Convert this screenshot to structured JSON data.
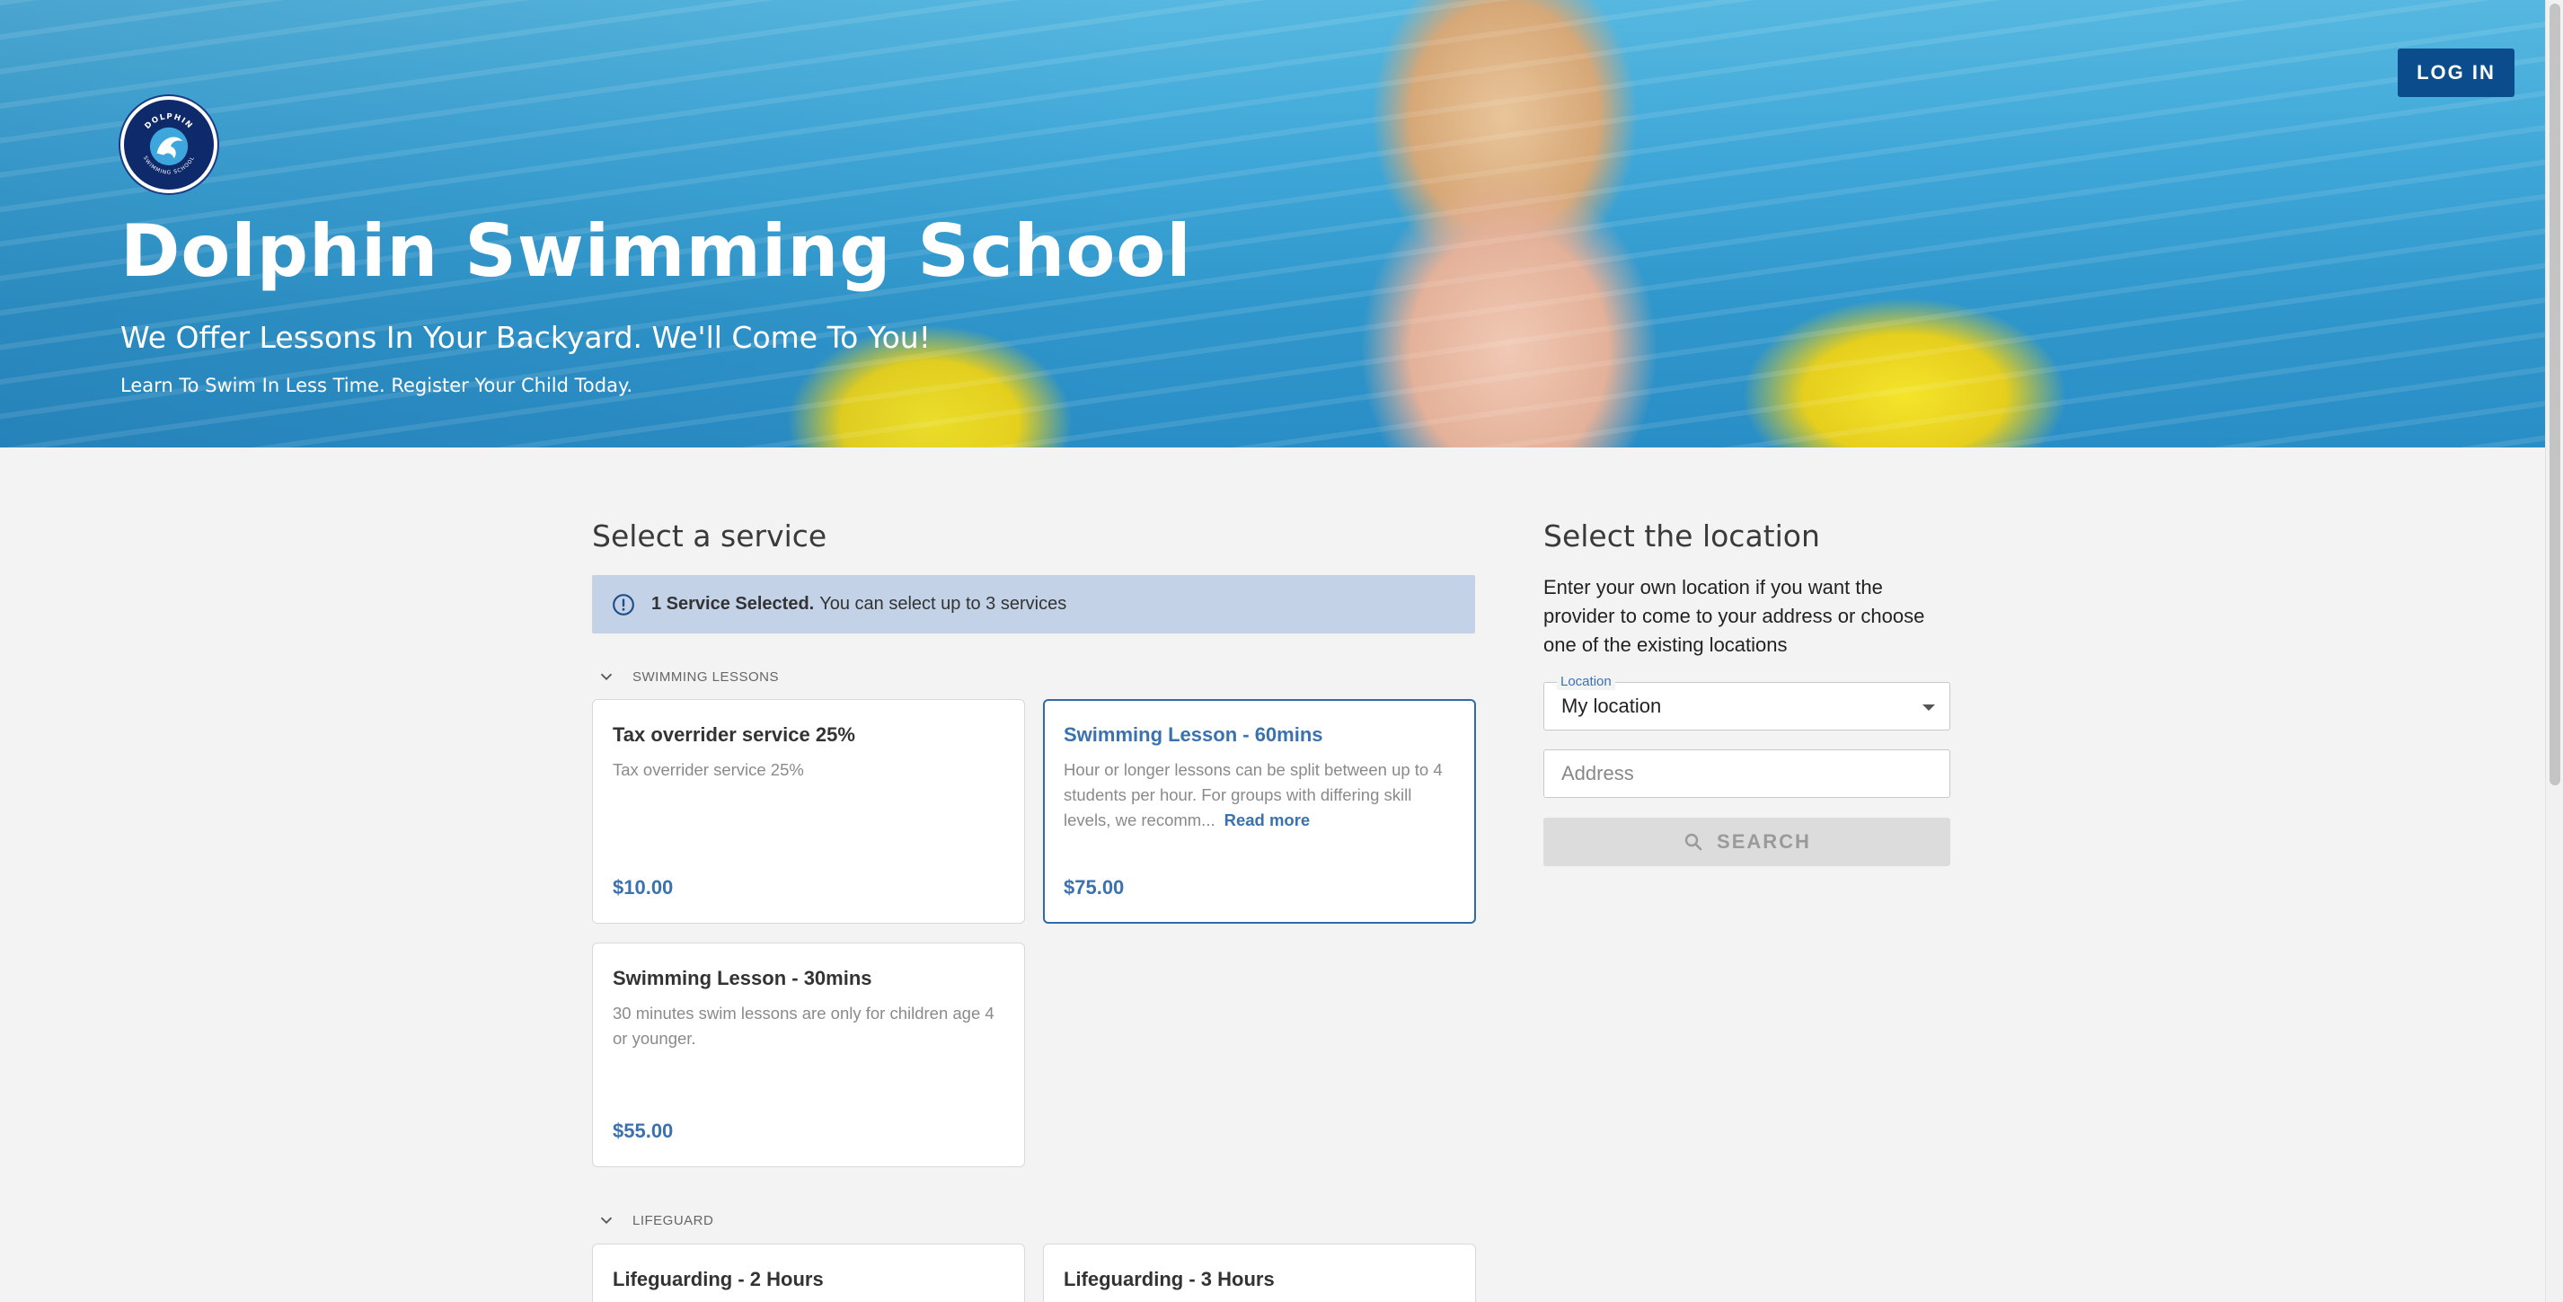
{
  "header": {
    "title": "Dolphin Swimming School",
    "subtitle": "We Offer Lessons In Your Backyard. We'll Come To You!",
    "tagline": "Learn To Swim In Less Time. Register Your Child Today.",
    "login_label": "LOG IN",
    "logo_text": "DOLPHIN SWIMMING SCHOOL"
  },
  "services": {
    "heading": "Select a service",
    "info_bold": "1 Service Selected.",
    "info_text": "You can select up to 3 services",
    "groups": [
      {
        "name": "SWIMMING LESSONS",
        "cards": [
          {
            "title": "Tax overrider service 25%",
            "description": "Tax overrider service 25%",
            "price": "$10.00",
            "selected": false
          },
          {
            "title": "Swimming Lesson - 60mins",
            "description": "Hour or longer lessons can be split between up to 4 students per hour. For groups with differing skill levels, we recomm...",
            "read_more": "Read more",
            "price": "$75.00",
            "selected": true
          },
          {
            "title": "Swimming Lesson - 30mins",
            "description": "30 minutes swim lessons are only for children age 4 or younger.",
            "price": "$55.00",
            "selected": false
          }
        ]
      },
      {
        "name": "LIFEGUARD",
        "cards": [
          {
            "title": "Lifeguarding - 2 Hours"
          },
          {
            "title": "Lifeguarding - 3 Hours"
          }
        ]
      }
    ]
  },
  "location": {
    "heading": "Select the location",
    "description": "Enter your own location if you want the provider to come to your address or choose one of the existing locations",
    "select_label": "Location",
    "select_value": "My location",
    "address_placeholder": "Address",
    "search_label": "SEARCH"
  },
  "colors": {
    "accent": "#3a72b0",
    "login_bg": "#0b4c8c",
    "info_bar_bg": "#c3d2e7",
    "page_bg": "#f3f3f3"
  }
}
